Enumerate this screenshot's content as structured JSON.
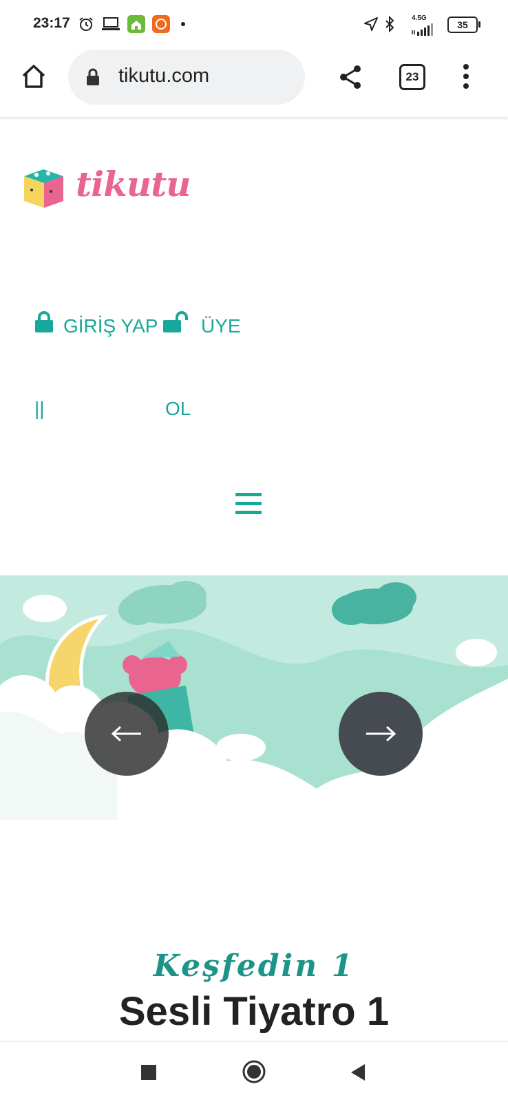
{
  "status_bar": {
    "time": "23:17",
    "network": "4.5G",
    "battery": "35",
    "icons": [
      "alarm-icon",
      "laptop-icon",
      "app-home-icon",
      "mi-icon",
      "dot-icon",
      "location-icon",
      "bluetooth-icon",
      "signal-icon",
      "battery-icon"
    ]
  },
  "browser": {
    "url": "tikutu.com",
    "tab_count": "23",
    "icons": [
      "home-icon",
      "lock-icon",
      "share-icon",
      "tabs-icon",
      "more-icon"
    ]
  },
  "site": {
    "logo_text": "tikutu",
    "login_label": "GİRİŞ YAP",
    "register_label": "ÜYE",
    "register_label_2": "OL",
    "separator": "||",
    "colors": {
      "teal": "#19a79a",
      "pink": "#e9658f"
    }
  },
  "main": {
    "subtitle": "Keşfedin 1",
    "title": "Sesli Tiyatro 1"
  },
  "system_nav": {
    "icons": [
      "recent-apps-icon",
      "home-circle-icon",
      "back-icon"
    ]
  }
}
